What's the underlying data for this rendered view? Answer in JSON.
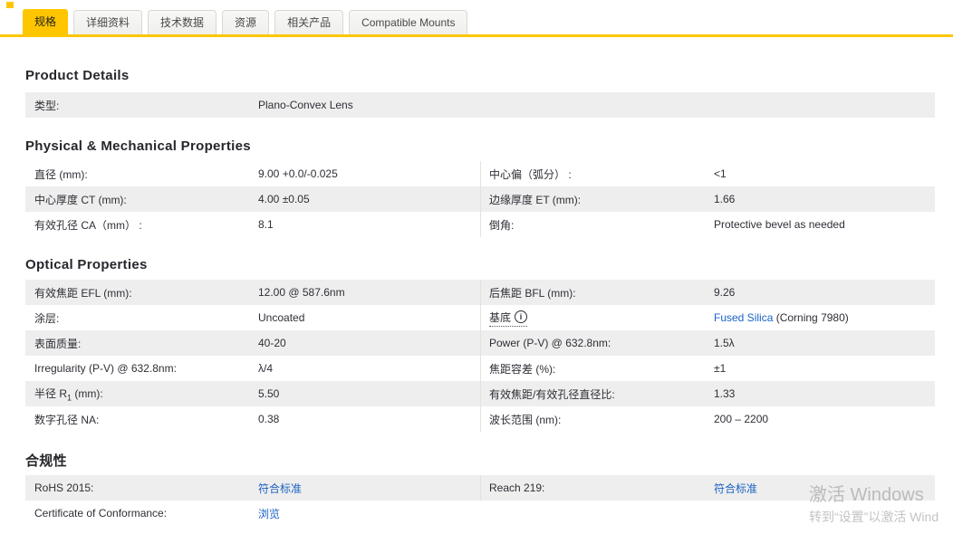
{
  "tabs": {
    "items": [
      {
        "label": "规格",
        "active": true
      },
      {
        "label": "详细资料",
        "active": false
      },
      {
        "label": "技术数据",
        "active": false
      },
      {
        "label": "资源",
        "active": false
      },
      {
        "label": "相关产品",
        "active": false
      },
      {
        "label": "Compatible Mounts",
        "active": false
      }
    ]
  },
  "product_details": {
    "heading": "Product Details",
    "rows": [
      {
        "label": "类型:",
        "value": "Plano-Convex Lens"
      }
    ]
  },
  "physical": {
    "heading": "Physical & Mechanical Properties",
    "left_rows": [
      {
        "label": "直径 (mm):",
        "value": "9.00 +0.0/-0.025"
      },
      {
        "label": "中心厚度 CT (mm):",
        "value": "4.00 ±0.05"
      },
      {
        "label": "有效孔径 CA（mm） :",
        "value": "8.1"
      }
    ],
    "right_rows": [
      {
        "label": "中心偏（弧分） :",
        "value": "<1"
      },
      {
        "label": "边缘厚度 ET (mm):",
        "value": "1.66"
      },
      {
        "label": "倒角:",
        "value": "Protective bevel as needed"
      }
    ]
  },
  "optical": {
    "heading": "Optical Properties",
    "left_rows": [
      {
        "label": "有效焦距 EFL (mm):",
        "value": "12.00 @ 587.6nm"
      },
      {
        "label": "涂层:",
        "value": "Uncoated"
      },
      {
        "label": "表面质量:",
        "value": "40-20"
      },
      {
        "label": "Irregularity (P-V) @ 632.8nm:",
        "value": "λ/4"
      },
      {
        "label_prefix": "半径 R",
        "label_sub": "1",
        "label_suffix": " (mm):",
        "value": "5.50"
      },
      {
        "label": "数字孔径 NA:",
        "value": "0.38"
      }
    ],
    "right_rows": [
      {
        "label": "后焦距 BFL (mm):",
        "value": "9.26"
      },
      {
        "label": "基底",
        "info_icon_glyph": "i",
        "value_link": "Fused Silica",
        "value_suffix": " (Corning 7980)"
      },
      {
        "label": "Power (P-V) @ 632.8nm:",
        "value": "1.5λ"
      },
      {
        "label": "焦距容差 (%):",
        "value": "±1"
      },
      {
        "label": "有效焦距/有效孔径直径比:",
        "value": "1.33"
      },
      {
        "label": "波长范围 (nm):",
        "value": "200 – 2200"
      }
    ]
  },
  "compliance": {
    "heading": "合规性",
    "left_rows": [
      {
        "label": "RoHS 2015:",
        "link": "符合标准"
      },
      {
        "label": "Certificate of Conformance:",
        "link": "浏览"
      }
    ],
    "right_rows": [
      {
        "label": "Reach 219:",
        "link": "符合标准"
      }
    ]
  },
  "watermark": {
    "line1": "激活 Windows",
    "line2": "转到“设置”以激活 Wind"
  },
  "colors": {
    "accent_yellow": "#ffc600",
    "link_blue": "#1a63c5",
    "row_gray": "#efeeee",
    "text_dark": "#2e2e36"
  }
}
